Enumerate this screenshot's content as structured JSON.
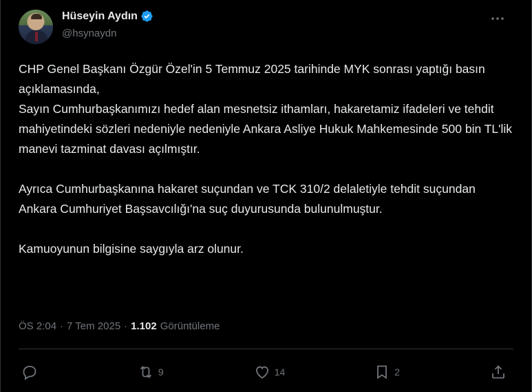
{
  "author": {
    "display_name": "Hüseyin Aydın",
    "handle": "@hsynaydn"
  },
  "tweet": {
    "text": "CHP Genel Başkanı Özgür Özel'in 5 Temmuz 2025 tarihinde MYK sonrası yaptığı basın açıklamasında,\nSayın Cumhurbaşkanımızı hedef alan mesnetsiz ithamları, hakaretamiz ifadeleri ve tehdit mahiyetindeki sözleri nedeniyle nedeniyle Ankara Asliye Hukuk Mahkemesinde 500 bin TL'lik manevi tazminat davası açılmıştır.\n\nAyrıca Cumhurbaşkanına hakaret suçundan ve TCK 310/2 delaletiyle tehdit suçundan Ankara Cumhuriyet Başsavcılığı'na suç duyurusunda bulunulmuştur.\n\nKamuoyunun bilgisine saygıyla arz olunur.",
    "time": "ÖS 2:04",
    "separator": "·",
    "date": "7 Tem 2025",
    "views_count": "1.102",
    "views_label": "Görüntüleme"
  },
  "actions": {
    "reply_count": "",
    "retweet_count": "9",
    "like_count": "14",
    "bookmark_count": "2"
  },
  "colors": {
    "background": "#000000",
    "text": "#e7e9ea",
    "muted": "#71767b",
    "border": "#2f3336",
    "verified": "#1d9bf0"
  }
}
